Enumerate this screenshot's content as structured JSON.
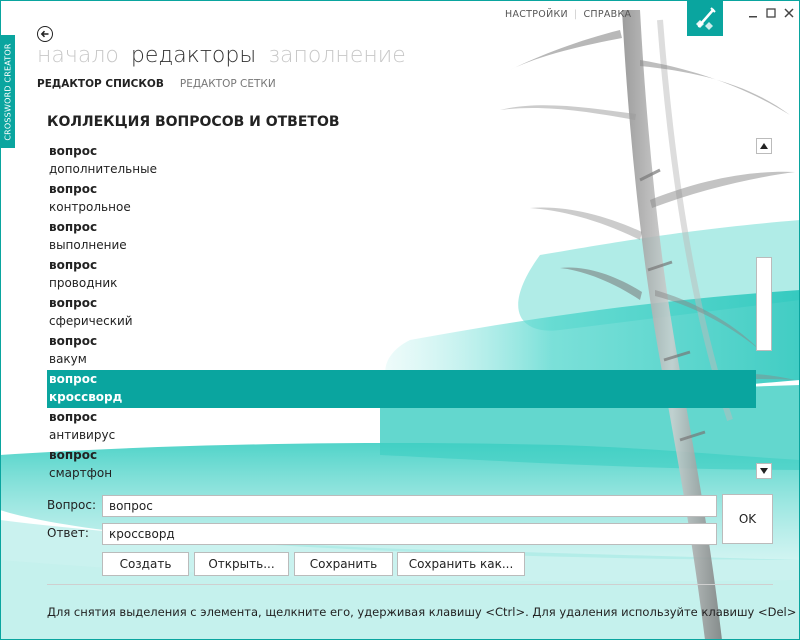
{
  "app": {
    "side_tab": "CROSSWORD CREATOR"
  },
  "top_links": {
    "settings": "НАСТРОЙКИ",
    "help": "СПРАВКА"
  },
  "nav_main": [
    "начало",
    "редакторы",
    "заполнение"
  ],
  "nav_main_active": 1,
  "nav_sub": [
    "РЕДАКТОР СПИСКОВ",
    "РЕДАКТОР СЕТКИ"
  ],
  "nav_sub_active": 0,
  "section_title": "КОЛЛЕКЦИЯ ВОПРОСОВ И ОТВЕТОВ",
  "list": [
    {
      "q": "вопрос",
      "a": "дополнительные"
    },
    {
      "q": "вопрос",
      "a": "контрольное"
    },
    {
      "q": "вопрос",
      "a": "выполнение"
    },
    {
      "q": "вопрос",
      "a": "проводник"
    },
    {
      "q": "вопрос",
      "a": "сферический"
    },
    {
      "q": "вопрос",
      "a": "вакум"
    },
    {
      "q": "вопрос",
      "a": "кроссворд",
      "selected": true
    },
    {
      "q": "вопрос",
      "a": "антивирус"
    },
    {
      "q": "вопрос",
      "a": "смартфон"
    }
  ],
  "form": {
    "question_label": "Вопрос:",
    "question_value": "вопрос",
    "answer_label": "Ответ:",
    "answer_value": "кроссворд",
    "ok_label": "OK"
  },
  "buttons": {
    "create": "Создать",
    "open": "Открыть...",
    "save": "Сохранить",
    "save_as": "Сохранить как..."
  },
  "hint": "Для снятия выделения с элемента, щелкните его, удерживая клавишу <Ctrl>. Для удаления используйте клавишу <Del>",
  "colors": {
    "accent": "#0aa59f",
    "selected_row": "#0aa59f"
  },
  "icons": {
    "back": "arrow-left-circle-icon",
    "logo": "pencil-grid-icon",
    "minimize": "minimize-icon",
    "maximize": "maximize-icon",
    "close": "close-icon",
    "scroll_up": "triangle-up-icon",
    "scroll_down": "triangle-down-icon"
  }
}
